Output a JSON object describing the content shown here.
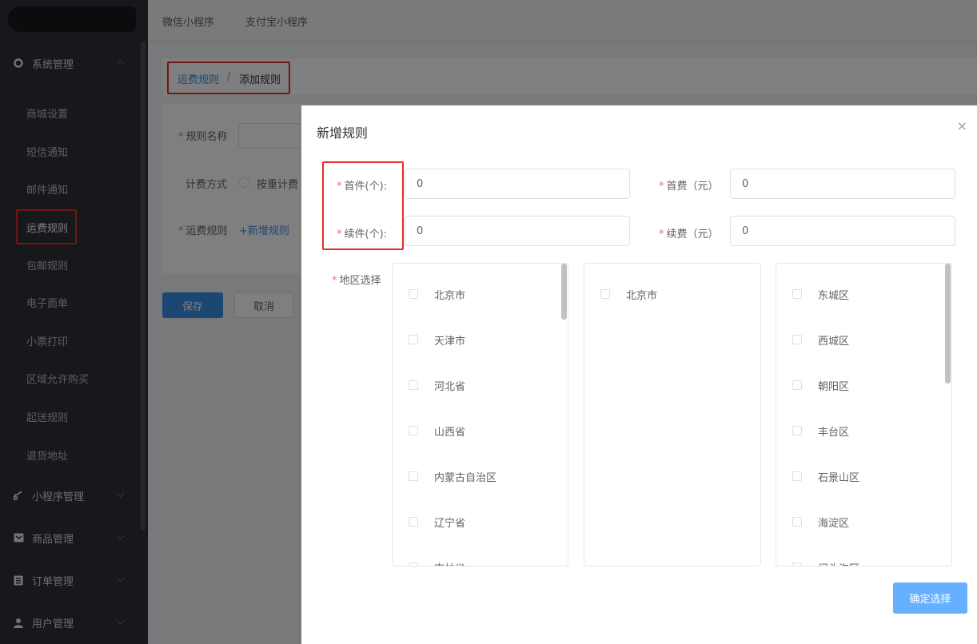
{
  "topbar": {
    "tabs": [
      "微信小程序",
      "支付宝小程序"
    ]
  },
  "sidebar": {
    "groups": [
      {
        "label": "系统管理",
        "icon": "gear-icon"
      },
      {
        "label": "小程序管理",
        "icon": "mini-program-icon"
      },
      {
        "label": "商品管理",
        "icon": "goods-icon"
      },
      {
        "label": "订单管理",
        "icon": "order-icon"
      },
      {
        "label": "用户管理",
        "icon": "user-icon"
      }
    ],
    "items": [
      "商城设置",
      "短信通知",
      "邮件通知",
      "运费规则",
      "包邮规则",
      "电子面单",
      "小票打印",
      "区域允许购买",
      "起送规则",
      "退货地址"
    ],
    "active_item": "运费规则"
  },
  "breadcrumb": {
    "parent": "运费规则",
    "separator": "/",
    "current": "添加规则"
  },
  "form": {
    "rule_name_label": "规则名称",
    "billing_label": "计费方式",
    "billing_option": "按重计费",
    "shipping_rule_label": "运费规则",
    "add_rule_link": "+新增规则",
    "save_button": "保存",
    "cancel_button": "取消"
  },
  "dialog": {
    "title": "新增规则",
    "close": "×",
    "first_unit_label": "首件(个):",
    "first_unit_value": "0",
    "first_fee_label": "首费（元）",
    "first_fee_value": "0",
    "additional_unit_label": "续件(个):",
    "additional_unit_value": "0",
    "additional_fee_label": "续费（元）",
    "additional_fee_value": "0",
    "region_label": "地区选择",
    "provinces": [
      "北京市",
      "天津市",
      "河北省",
      "山西省",
      "内蒙古自治区",
      "辽宁省",
      "吉林省"
    ],
    "cities": [
      "北京市"
    ],
    "districts": [
      "东城区",
      "西城区",
      "朝阳区",
      "丰台区",
      "石景山区",
      "海淀区",
      "门头沟区"
    ],
    "confirm_button": "确定选择"
  },
  "colors": {
    "required": "#f56c6c",
    "primary": "#3a8ee6",
    "highlight": "#e82a2a",
    "sidebar_bg": "#2d3138"
  }
}
